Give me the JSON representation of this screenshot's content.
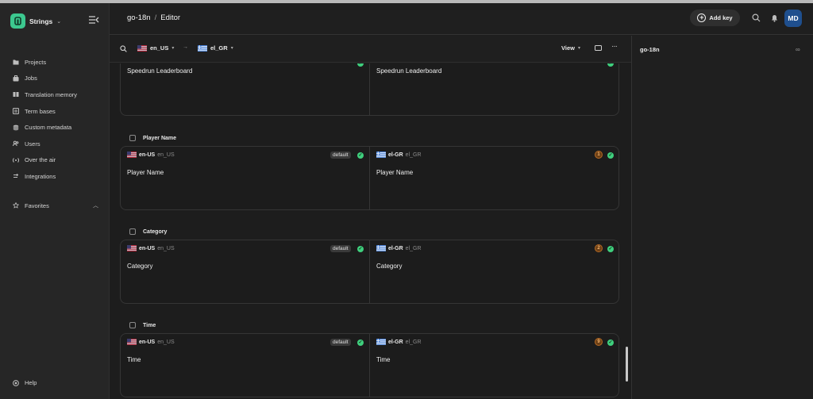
{
  "app": {
    "name": "Strings",
    "chevron": "⌄"
  },
  "sidebar": {
    "items": [
      {
        "label": "Projects",
        "icon": "folder-icon"
      },
      {
        "label": "Jobs",
        "icon": "briefcase-icon"
      },
      {
        "label": "Translation memory",
        "icon": "book-icon"
      },
      {
        "label": "Term bases",
        "icon": "list-icon"
      },
      {
        "label": "Custom metadata",
        "icon": "database-icon"
      },
      {
        "label": "Users",
        "icon": "users-icon"
      },
      {
        "label": "Over the air",
        "icon": "broadcast-icon"
      },
      {
        "label": "Integrations",
        "icon": "arrows-icon"
      }
    ],
    "favorites_label": "Favorites",
    "help_label": "Help"
  },
  "header": {
    "project": "go-18n",
    "separator": "/",
    "page": "Editor",
    "add_key_label": "Add key",
    "avatar_initials": "MD"
  },
  "toolbar": {
    "source_lang": "en_US",
    "target_lang": "el_GR",
    "view_label": "View",
    "more": "···"
  },
  "right_panel": {
    "title": "go-18n"
  },
  "editor": {
    "default_tag": "default",
    "first_card": {
      "source_text": "Speedrun Leaderboard",
      "target_text": "Speedrun Leaderboard"
    },
    "keys": [
      {
        "name": "Player Name",
        "source_locale": "en-US",
        "source_locale_sub": "en_US",
        "source_text": "Player Name",
        "target_locale": "el-GR",
        "target_locale_sub": "el_GR",
        "target_text": "Player Name",
        "badge": "1"
      },
      {
        "name": "Category",
        "source_locale": "en-US",
        "source_locale_sub": "en_US",
        "source_text": "Category",
        "target_locale": "el-GR",
        "target_locale_sub": "el_GR",
        "target_text": "Category",
        "badge": "2"
      },
      {
        "name": "Time",
        "source_locale": "en-US",
        "source_locale_sub": "en_US",
        "source_text": "Time",
        "target_locale": "el-GR",
        "target_locale_sub": "el_GR",
        "target_text": "Time",
        "badge": "9"
      }
    ]
  },
  "colors": {
    "accent": "#3cc88f",
    "check": "#3fcf7d",
    "avatar": "#1f4f8e",
    "badge_bg": "#6b3f16"
  }
}
